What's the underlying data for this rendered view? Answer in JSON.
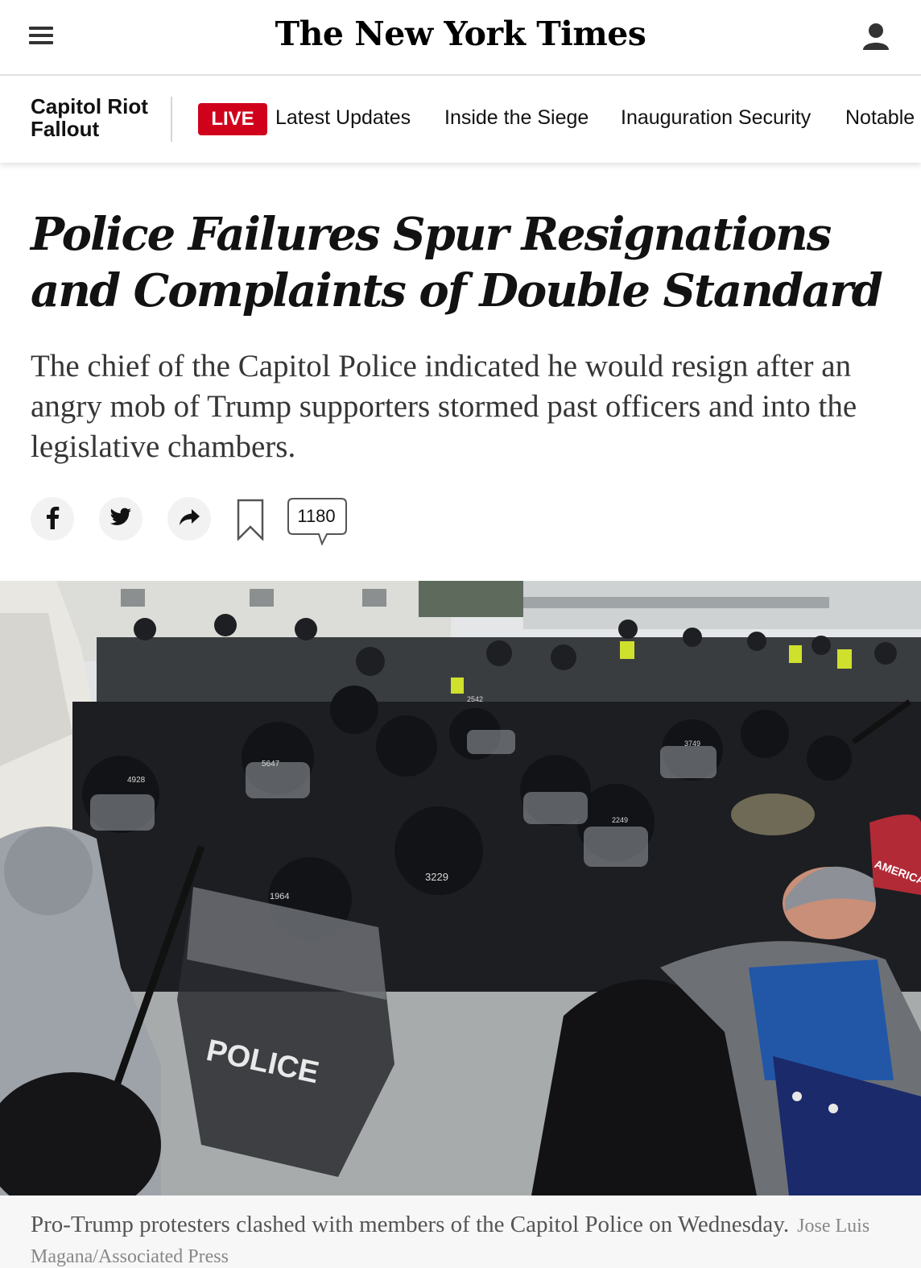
{
  "header": {
    "logo_text": "The New York Times",
    "menu_icon": "hamburger-menu-icon",
    "account_icon": "user-account-icon"
  },
  "section_nav": {
    "title": "Capitol Riot Fallout",
    "live_label": "LIVE",
    "links": [
      "Latest Updates",
      "Inside the Siege",
      "Inauguration Security",
      "Notable"
    ]
  },
  "article": {
    "headline": "Police Failures Spur Resignations and Complaints of Double Standard",
    "summary": "The chief of the Capitol Police indicated he would resign after an angry mob of Trump supporters stormed past officers and into the legislative chambers."
  },
  "share_tools": {
    "facebook_icon": "facebook-icon",
    "twitter_icon": "twitter-icon",
    "share_icon": "share-arrow-icon",
    "bookmark_icon": "bookmark-icon",
    "comment_count": "1180"
  },
  "photo": {
    "shield_text": "POLICE",
    "helmet_numbers": [
      "3229",
      "4928",
      "5647",
      "1964",
      "2542",
      "2249",
      "3749"
    ],
    "hat_text": "AMERICA"
  },
  "caption": {
    "text": "Pro-Trump protesters clashed with members of the Capitol Police on Wednesday.",
    "credit": "Jose Luis Magana/Associated Press"
  },
  "colors": {
    "live_red": "#d0021b",
    "text_dark": "#121212",
    "summary_gray": "#363636"
  }
}
